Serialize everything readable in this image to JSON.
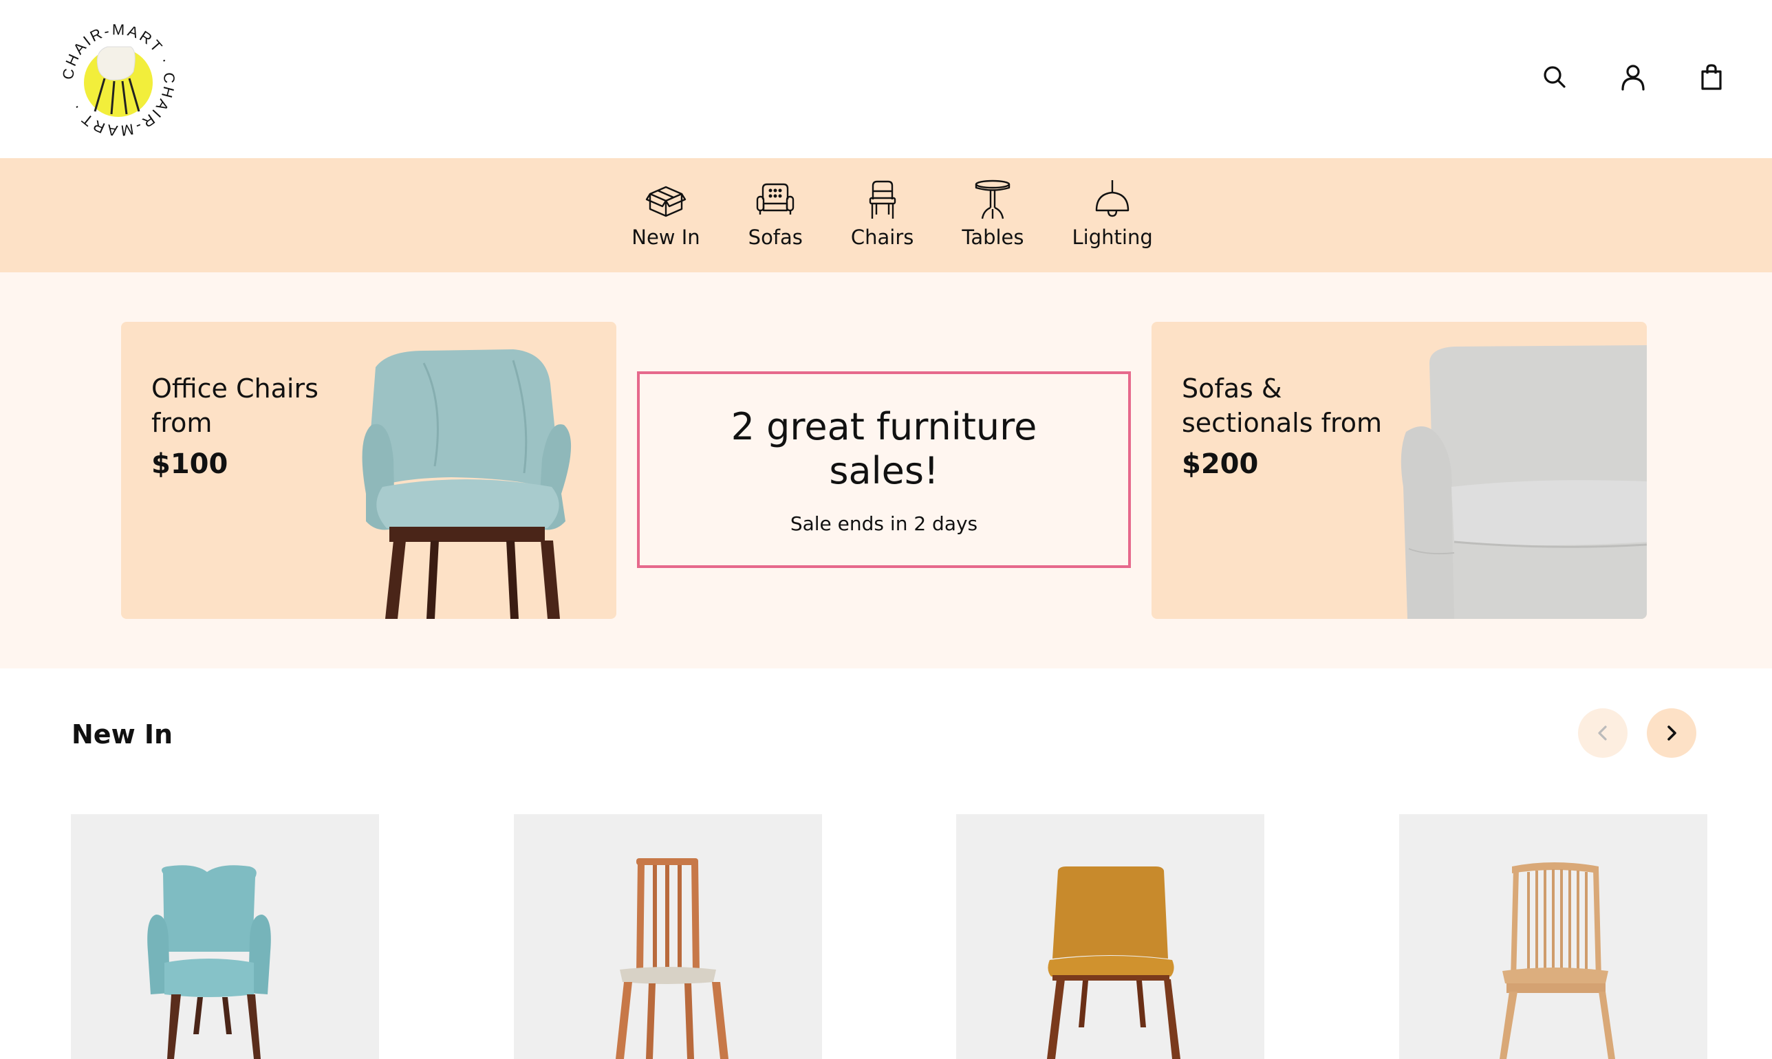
{
  "brand": {
    "logo_text": "CHAIR-MART · CHAIR-MART ·"
  },
  "header": {
    "icons": [
      "search-icon",
      "user-icon",
      "shopping-bag-icon"
    ]
  },
  "categories": [
    {
      "label": "New In",
      "icon": "box-icon"
    },
    {
      "label": "Sofas",
      "icon": "sofa-icon"
    },
    {
      "label": "Chairs",
      "icon": "chair-icon"
    },
    {
      "label": "Tables",
      "icon": "table-icon"
    },
    {
      "label": "Lighting",
      "icon": "lamp-icon"
    }
  ],
  "promo": {
    "left": {
      "title": "Office Chairs from",
      "price": "$100"
    },
    "center": {
      "title": "2 great furniture sales!",
      "subtitle": "Sale ends in 2 days"
    },
    "right": {
      "title": "Sofas & sectionals from",
      "price": "$200"
    }
  },
  "new_in": {
    "title": "New In",
    "products": [
      {
        "name": "blue-armchair"
      },
      {
        "name": "spindle-back-dining-chair"
      },
      {
        "name": "mustard-upholstered-chair"
      },
      {
        "name": "natural-wood-spindle-chair"
      }
    ]
  },
  "colors": {
    "accent_peach": "#fde1c6",
    "promo_bg": "#fff6f0",
    "sale_border": "#e6698c",
    "logo_yellow": "#f2ee3b"
  }
}
